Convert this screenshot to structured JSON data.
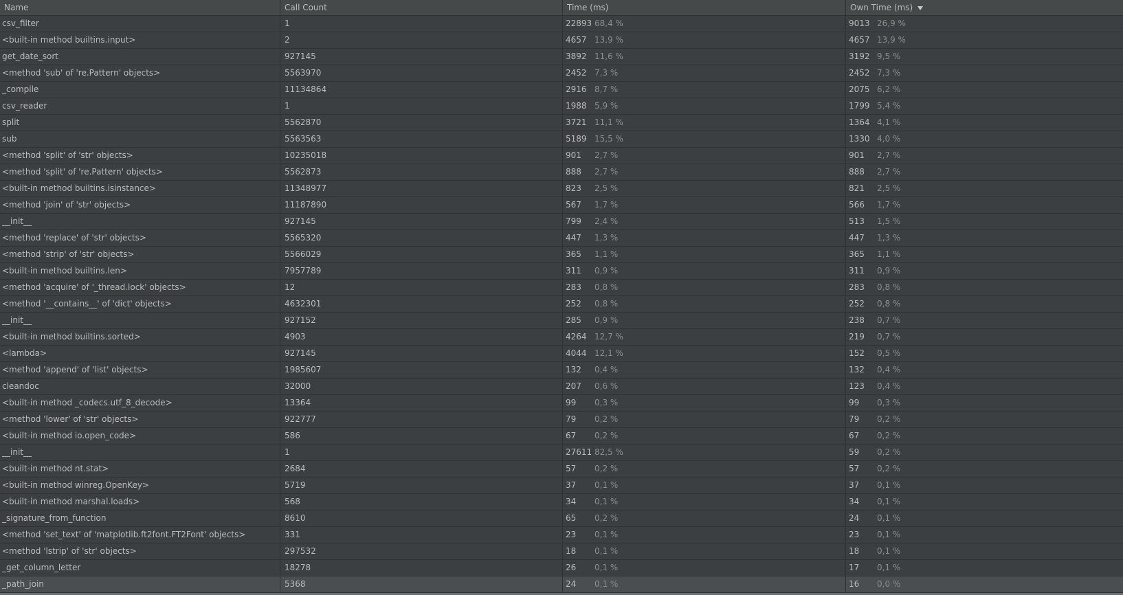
{
  "columns": {
    "name": "Name",
    "call_count": "Call Count",
    "time": "Time (ms)",
    "own_time": "Own Time (ms)"
  },
  "sort": {
    "column": "own_time",
    "direction": "descending"
  },
  "rows": [
    {
      "name": "csv_filter",
      "calls": "1",
      "time": "22893",
      "time_pct": "68,4 %",
      "own": "9013",
      "own_pct": "26,9 %"
    },
    {
      "name": "<built-in method builtins.input>",
      "calls": "2",
      "time": "4657",
      "time_pct": "13,9 %",
      "own": "4657",
      "own_pct": "13,9 %"
    },
    {
      "name": "get_date_sort",
      "calls": "927145",
      "time": "3892",
      "time_pct": "11,6 %",
      "own": "3192",
      "own_pct": "9,5 %"
    },
    {
      "name": "<method 'sub' of 're.Pattern' objects>",
      "calls": "5563970",
      "time": "2452",
      "time_pct": "7,3 %",
      "own": "2452",
      "own_pct": "7,3 %"
    },
    {
      "name": "_compile",
      "calls": "11134864",
      "time": "2916",
      "time_pct": "8,7 %",
      "own": "2075",
      "own_pct": "6,2 %"
    },
    {
      "name": "csv_reader",
      "calls": "1",
      "time": "1988",
      "time_pct": "5,9 %",
      "own": "1799",
      "own_pct": "5,4 %"
    },
    {
      "name": "split",
      "calls": "5562870",
      "time": "3721",
      "time_pct": "11,1 %",
      "own": "1364",
      "own_pct": "4,1 %"
    },
    {
      "name": "sub",
      "calls": "5563563",
      "time": "5189",
      "time_pct": "15,5 %",
      "own": "1330",
      "own_pct": "4,0 %"
    },
    {
      "name": "<method 'split' of 'str' objects>",
      "calls": "10235018",
      "time": "901",
      "time_pct": "2,7 %",
      "own": "901",
      "own_pct": "2,7 %"
    },
    {
      "name": "<method 'split' of 're.Pattern' objects>",
      "calls": "5562873",
      "time": "888",
      "time_pct": "2,7 %",
      "own": "888",
      "own_pct": "2,7 %"
    },
    {
      "name": "<built-in method builtins.isinstance>",
      "calls": "11348977",
      "time": "823",
      "time_pct": "2,5 %",
      "own": "821",
      "own_pct": "2,5 %"
    },
    {
      "name": "<method 'join' of 'str' objects>",
      "calls": "11187890",
      "time": "567",
      "time_pct": "1,7 %",
      "own": "566",
      "own_pct": "1,7 %"
    },
    {
      "name": "__init__",
      "calls": "927145",
      "time": "799",
      "time_pct": "2,4 %",
      "own": "513",
      "own_pct": "1,5 %"
    },
    {
      "name": "<method 'replace' of 'str' objects>",
      "calls": "5565320",
      "time": "447",
      "time_pct": "1,3 %",
      "own": "447",
      "own_pct": "1,3 %"
    },
    {
      "name": "<method 'strip' of 'str' objects>",
      "calls": "5566029",
      "time": "365",
      "time_pct": "1,1 %",
      "own": "365",
      "own_pct": "1,1 %"
    },
    {
      "name": "<built-in method builtins.len>",
      "calls": "7957789",
      "time": "311",
      "time_pct": "0,9 %",
      "own": "311",
      "own_pct": "0,9 %"
    },
    {
      "name": "<method 'acquire' of '_thread.lock' objects>",
      "calls": "12",
      "time": "283",
      "time_pct": "0,8 %",
      "own": "283",
      "own_pct": "0,8 %"
    },
    {
      "name": "<method '__contains__' of 'dict' objects>",
      "calls": "4632301",
      "time": "252",
      "time_pct": "0,8 %",
      "own": "252",
      "own_pct": "0,8 %"
    },
    {
      "name": "__init__",
      "calls": "927152",
      "time": "285",
      "time_pct": "0,9 %",
      "own": "238",
      "own_pct": "0,7 %"
    },
    {
      "name": "<built-in method builtins.sorted>",
      "calls": "4903",
      "time": "4264",
      "time_pct": "12,7 %",
      "own": "219",
      "own_pct": "0,7 %"
    },
    {
      "name": "<lambda>",
      "calls": "927145",
      "time": "4044",
      "time_pct": "12,1 %",
      "own": "152",
      "own_pct": "0,5 %"
    },
    {
      "name": "<method 'append' of 'list' objects>",
      "calls": "1985607",
      "time": "132",
      "time_pct": "0,4 %",
      "own": "132",
      "own_pct": "0,4 %"
    },
    {
      "name": "cleandoc",
      "calls": "32000",
      "time": "207",
      "time_pct": "0,6 %",
      "own": "123",
      "own_pct": "0,4 %"
    },
    {
      "name": "<built-in method _codecs.utf_8_decode>",
      "calls": "13364",
      "time": "99",
      "time_pct": "0,3 %",
      "own": "99",
      "own_pct": "0,3 %"
    },
    {
      "name": "<method 'lower' of 'str' objects>",
      "calls": "922777",
      "time": "79",
      "time_pct": "0,2 %",
      "own": "79",
      "own_pct": "0,2 %"
    },
    {
      "name": "<built-in method io.open_code>",
      "calls": "586",
      "time": "67",
      "time_pct": "0,2 %",
      "own": "67",
      "own_pct": "0,2 %"
    },
    {
      "name": "__init__",
      "calls": "1",
      "time": "27611",
      "time_pct": "82,5 %",
      "own": "59",
      "own_pct": "0,2 %"
    },
    {
      "name": "<built-in method nt.stat>",
      "calls": "2684",
      "time": "57",
      "time_pct": "0,2 %",
      "own": "57",
      "own_pct": "0,2 %"
    },
    {
      "name": "<built-in method winreg.OpenKey>",
      "calls": "5719",
      "time": "37",
      "time_pct": "0,1 %",
      "own": "37",
      "own_pct": "0,1 %"
    },
    {
      "name": "<built-in method marshal.loads>",
      "calls": "568",
      "time": "34",
      "time_pct": "0,1 %",
      "own": "34",
      "own_pct": "0,1 %"
    },
    {
      "name": "_signature_from_function",
      "calls": "8610",
      "time": "65",
      "time_pct": "0,2 %",
      "own": "24",
      "own_pct": "0,1 %"
    },
    {
      "name": "<method 'set_text' of 'matplotlib.ft2font.FT2Font' objects>",
      "calls": "331",
      "time": "23",
      "time_pct": "0,1 %",
      "own": "23",
      "own_pct": "0,1 %"
    },
    {
      "name": "<method 'lstrip' of 'str' objects>",
      "calls": "297532",
      "time": "18",
      "time_pct": "0,1 %",
      "own": "18",
      "own_pct": "0,1 %"
    },
    {
      "name": "_get_column_letter",
      "calls": "18278",
      "time": "26",
      "time_pct": "0,1 %",
      "own": "17",
      "own_pct": "0,1 %"
    },
    {
      "name": "_path_join",
      "calls": "5368",
      "time": "24",
      "time_pct": "0,1 %",
      "own": "16",
      "own_pct": "0,0 %"
    }
  ]
}
